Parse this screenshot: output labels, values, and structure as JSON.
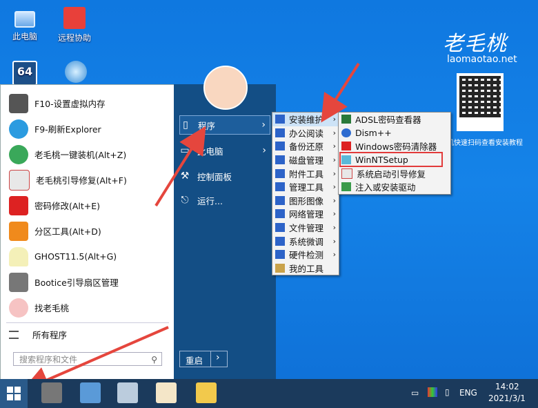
{
  "desktop": {
    "icons": [
      {
        "label": "此电脑"
      },
      {
        "label": "远程协助"
      },
      {
        "label": "64"
      }
    ]
  },
  "brand": {
    "logo": "老毛桃",
    "site": "laomaotao.net",
    "qr_caption": "机快速扫码查看安装教程"
  },
  "start_menu": {
    "left_items": [
      {
        "label": "F10-设置虚拟内存"
      },
      {
        "label": "F9-刷新Explorer"
      },
      {
        "label": "老毛桃一键装机(Alt+Z)"
      },
      {
        "label": "老毛桃引导修复(Alt+F)"
      },
      {
        "label": "密码修改(Alt+E)"
      },
      {
        "label": "分区工具(Alt+D)"
      },
      {
        "label": "GHOST11.5(Alt+G)"
      },
      {
        "label": "Bootice引导扇区管理"
      },
      {
        "label": "找老毛桃"
      }
    ],
    "all_programs": "所有程序",
    "search_placeholder": "搜索程序和文件",
    "right_items": [
      {
        "label": "程序"
      },
      {
        "label": "此电脑"
      },
      {
        "label": "控制面板"
      },
      {
        "label": "运行..."
      }
    ],
    "restart": "重启"
  },
  "programs_menu": {
    "items": [
      {
        "label": "安装维护"
      },
      {
        "label": "办公阅读"
      },
      {
        "label": "备份还原"
      },
      {
        "label": "磁盘管理"
      },
      {
        "label": "附件工具"
      },
      {
        "label": "管理工具"
      },
      {
        "label": "图形图像"
      },
      {
        "label": "网络管理"
      },
      {
        "label": "文件管理"
      },
      {
        "label": "系统微调"
      },
      {
        "label": "硬件检测"
      },
      {
        "label": "我的工具"
      }
    ]
  },
  "install_menu": {
    "items": [
      {
        "label": "ADSL密码查看器"
      },
      {
        "label": "Dism++"
      },
      {
        "label": "Windows密码清除器"
      },
      {
        "label": "WinNTSetup"
      },
      {
        "label": "系统启动引导修复"
      },
      {
        "label": "注入或安装驱动"
      }
    ]
  },
  "taskbar": {
    "lang": "ENG",
    "time": "14:02",
    "date": "2021/3/1"
  },
  "colors": {
    "accent": "#134e85",
    "highlight": "#e23a3a",
    "arrow": "#e5463d"
  }
}
